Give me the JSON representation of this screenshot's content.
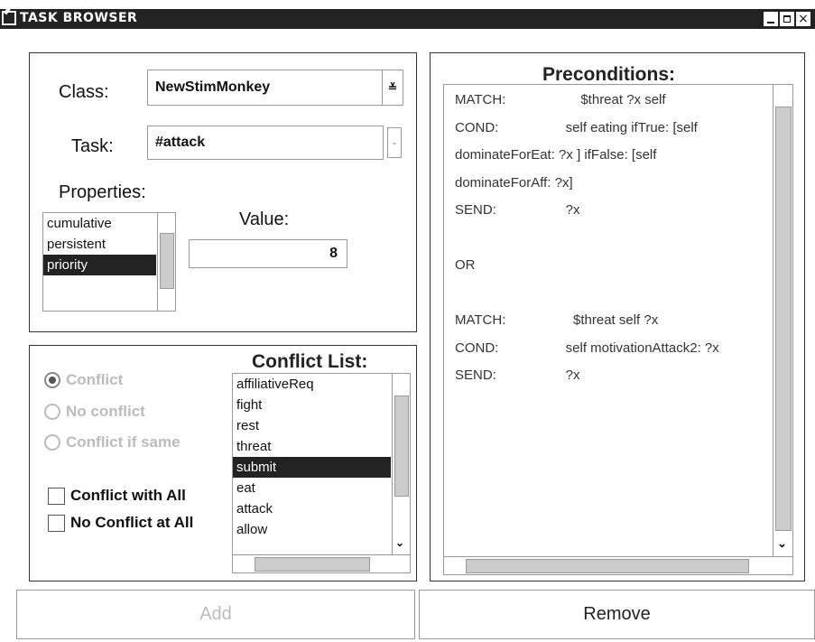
{
  "window": {
    "title": "TASK BROWSER",
    "controls": {
      "minimize": "_",
      "maximize": "□",
      "close": "×"
    }
  },
  "task_panel": {
    "class_label": "Class:",
    "class_value": "NewStimMonkey",
    "task_label": "Task:",
    "task_value": "#attack",
    "properties_label": "Properties:",
    "properties": [
      {
        "label": "cumulative",
        "selected": false
      },
      {
        "label": "persistent",
        "selected": false
      },
      {
        "label": "priority",
        "selected": true
      }
    ],
    "value_label": "Value:",
    "value": "8"
  },
  "conflict_panel": {
    "title": "Conflict List:",
    "radios": [
      {
        "label": "Conflict",
        "checked": true
      },
      {
        "label": "No conflict",
        "checked": false
      },
      {
        "label": "Conflict if same",
        "checked": false
      }
    ],
    "checkboxes": [
      {
        "label": "Conflict with All",
        "checked": false
      },
      {
        "label": "No Conflict at All",
        "checked": false
      }
    ],
    "items": [
      {
        "label": "affiliativeReq",
        "selected": false
      },
      {
        "label": "fight",
        "selected": false
      },
      {
        "label": "rest",
        "selected": false
      },
      {
        "label": "threat",
        "selected": false
      },
      {
        "label": "submit",
        "selected": true
      },
      {
        "label": "eat",
        "selected": false
      },
      {
        "label": "attack",
        "selected": false
      },
      {
        "label": "allow",
        "selected": false
      }
    ]
  },
  "preconditions": {
    "title": "Preconditions:",
    "lines": [
      {
        "key": "MATCH:",
        "value": "        $threat ?x self"
      },
      {
        "key": "COND:",
        "value": "    self eating ifTrue: [self"
      },
      {
        "key": "",
        "value": "dominateForEat: ?x ] ifFalse: [self"
      },
      {
        "key": "",
        "value": "dominateForAff: ?x]"
      },
      {
        "key": "SEND:",
        "value": "    ?x"
      },
      {
        "key": "",
        "value": ""
      },
      {
        "key": "OR",
        "value": ""
      },
      {
        "key": "",
        "value": ""
      },
      {
        "key": "MATCH:",
        "value": "      $threat self ?x"
      },
      {
        "key": "COND:",
        "value": "    self motivationAttack2: ?x"
      },
      {
        "key": "SEND:",
        "value": "    ?x"
      }
    ]
  },
  "buttons": {
    "add": "Add",
    "remove": "Remove"
  },
  "colors": {
    "titlebar": "#222222",
    "selection": "#222222",
    "disabled_text": "#bbbbbb"
  }
}
